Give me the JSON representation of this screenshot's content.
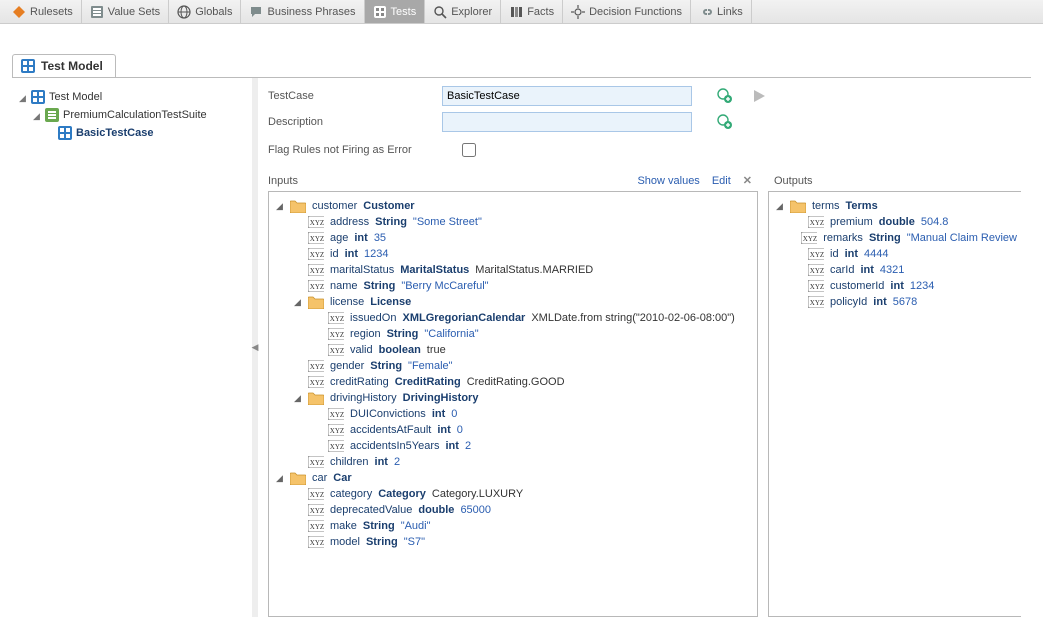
{
  "tabs": [
    {
      "label": "Rulesets"
    },
    {
      "label": "Value Sets"
    },
    {
      "label": "Globals"
    },
    {
      "label": "Business Phrases"
    },
    {
      "label": "Tests"
    },
    {
      "label": "Explorer"
    },
    {
      "label": "Facts"
    },
    {
      "label": "Decision Functions"
    },
    {
      "label": "Links"
    }
  ],
  "active_tab_index": 4,
  "page_tab": "Test Model",
  "tree": {
    "root": "Test Model",
    "suite": "PremiumCalculationTestSuite",
    "testcase": "BasicTestCase"
  },
  "form": {
    "testcase_label": "TestCase",
    "testcase_value": "BasicTestCase",
    "description_label": "Description",
    "description_value": "",
    "flag_label": "Flag Rules not Firing as Error"
  },
  "sections": {
    "inputs_title": "Inputs",
    "outputs_title": "Outputs",
    "show_values": "Show values",
    "edit": "Edit"
  },
  "inputs": [
    {
      "d": 0,
      "kind": "folder",
      "name": "customer",
      "type": "Customer"
    },
    {
      "d": 1,
      "kind": "xyz",
      "name": "address",
      "type": "String",
      "val": "\"Some Street\""
    },
    {
      "d": 1,
      "kind": "xyz",
      "name": "age",
      "type": "int",
      "val": "35"
    },
    {
      "d": 1,
      "kind": "xyz",
      "name": "id",
      "type": "int",
      "val": "1234"
    },
    {
      "d": 1,
      "kind": "xyz",
      "name": "maritalStatus",
      "type": "MaritalStatus",
      "lit": "MaritalStatus.MARRIED"
    },
    {
      "d": 1,
      "kind": "xyz",
      "name": "name",
      "type": "String",
      "val": "\"Berry McCareful\""
    },
    {
      "d": 1,
      "kind": "folder",
      "name": "license",
      "type": "License"
    },
    {
      "d": 2,
      "kind": "xyz",
      "name": "issuedOn",
      "type": "XMLGregorianCalendar",
      "lit": "XMLDate.from string(\"2010-02-06-08:00\")"
    },
    {
      "d": 2,
      "kind": "xyz",
      "name": "region",
      "type": "String",
      "val": "\"California\""
    },
    {
      "d": 2,
      "kind": "xyz",
      "name": "valid",
      "type": "boolean",
      "lit": "true"
    },
    {
      "d": 1,
      "kind": "xyz",
      "name": "gender",
      "type": "String",
      "val": "\"Female\""
    },
    {
      "d": 1,
      "kind": "xyz",
      "name": "creditRating",
      "type": "CreditRating",
      "lit": "CreditRating.GOOD"
    },
    {
      "d": 1,
      "kind": "folder",
      "name": "drivingHistory",
      "type": "DrivingHistory"
    },
    {
      "d": 2,
      "kind": "xyz",
      "name": "DUIConvictions",
      "type": "int",
      "val": "0"
    },
    {
      "d": 2,
      "kind": "xyz",
      "name": "accidentsAtFault",
      "type": "int",
      "val": "0"
    },
    {
      "d": 2,
      "kind": "xyz",
      "name": "accidentsIn5Years",
      "type": "int",
      "val": "2"
    },
    {
      "d": 1,
      "kind": "xyz",
      "name": "children",
      "type": "int",
      "val": "2"
    },
    {
      "d": 0,
      "kind": "folder",
      "name": "car",
      "type": "Car"
    },
    {
      "d": 1,
      "kind": "xyz",
      "name": "category",
      "type": "Category",
      "lit": "Category.LUXURY"
    },
    {
      "d": 1,
      "kind": "xyz",
      "name": "deprecatedValue",
      "type": "double",
      "val": "65000"
    },
    {
      "d": 1,
      "kind": "xyz",
      "name": "make",
      "type": "String",
      "val": "\"Audi\""
    },
    {
      "d": 1,
      "kind": "xyz",
      "name": "model",
      "type": "String",
      "val": "\"S7\""
    }
  ],
  "outputs": [
    {
      "d": 0,
      "kind": "folder",
      "name": "terms",
      "type": "Terms"
    },
    {
      "d": 1,
      "kind": "xyz",
      "name": "premium",
      "type": "double",
      "val": "504.8"
    },
    {
      "d": 1,
      "kind": "xyz",
      "name": "remarks",
      "type": "String",
      "val": "\"Manual Claim Review"
    },
    {
      "d": 1,
      "kind": "xyz",
      "name": "id",
      "type": "int",
      "val": "4444"
    },
    {
      "d": 1,
      "kind": "xyz",
      "name": "carId",
      "type": "int",
      "val": "4321"
    },
    {
      "d": 1,
      "kind": "xyz",
      "name": "customerId",
      "type": "int",
      "val": "1234"
    },
    {
      "d": 1,
      "kind": "xyz",
      "name": "policyId",
      "type": "int",
      "val": "5678"
    }
  ]
}
